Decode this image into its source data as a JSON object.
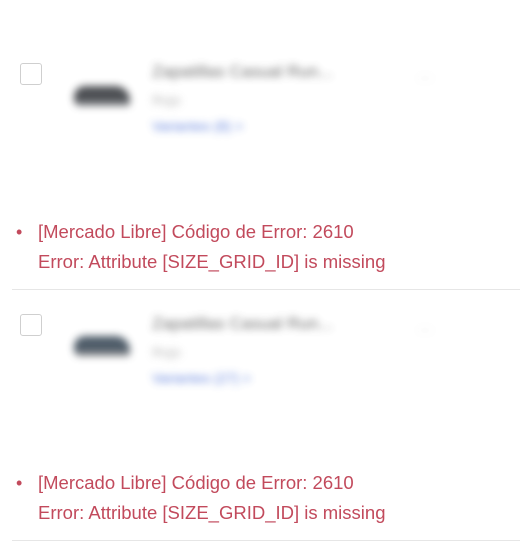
{
  "products": [
    {
      "title": "Zapatillas Casual Run...",
      "subtitle": "Rojo",
      "variants_label": "Variantes (8) >",
      "aux": "…",
      "error": {
        "line1": "[Mercado Libre] Código de Error: 2610",
        "line2": "Error: Attribute [SIZE_GRID_ID] is missing"
      }
    },
    {
      "title": "Zapatillas Casual Run...",
      "subtitle": "Rojo",
      "variants_label": "Variantes (27) >",
      "aux": "…",
      "error": {
        "line1": "[Mercado Libre] Código de Error: 2610",
        "line2": "Error: Attribute [SIZE_GRID_ID] is missing"
      }
    }
  ],
  "icons": {
    "bullet": "•"
  },
  "colors": {
    "error_text": "#c24a5c",
    "link": "#4a6fd8",
    "divider": "#e6e6e6"
  }
}
